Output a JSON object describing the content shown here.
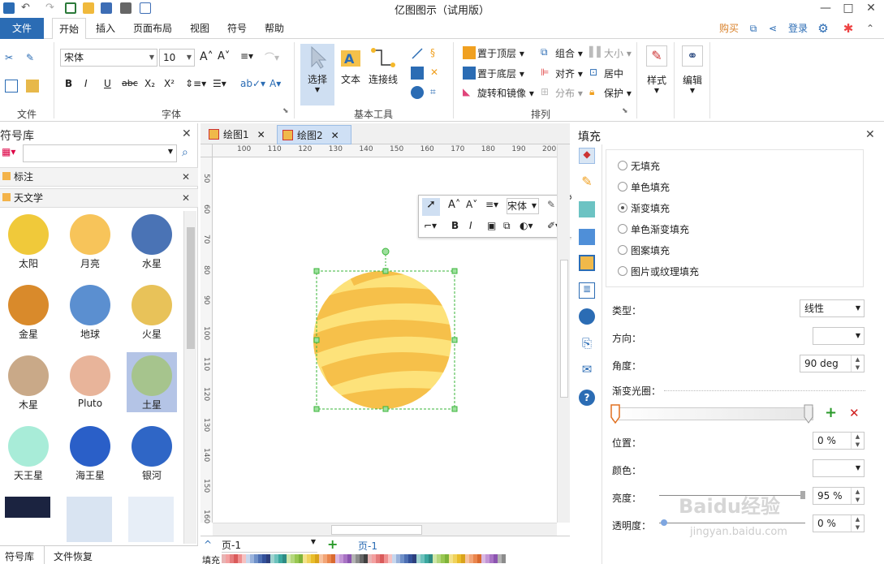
{
  "app": {
    "title": "亿图图示（试用版）"
  },
  "menu": {
    "items": [
      "文件",
      "开始",
      "插入",
      "页面布局",
      "视图",
      "符号",
      "帮助"
    ],
    "right": {
      "buy": "购买",
      "login": "登录"
    }
  },
  "ribbon": {
    "groups": {
      "file": "文件",
      "font": "字体",
      "basic_tools": "基本工具",
      "arrange": "排列"
    },
    "font_name": "宋体",
    "font_size": "10",
    "basic": {
      "select": "选择",
      "text": "文本",
      "connector": "连接线"
    },
    "arrange": {
      "bring_front": "置于顶层",
      "send_back": "置于底层",
      "rotate": "旋转和镜像",
      "group": "组合",
      "align": "对齐",
      "distribute": "分布",
      "size": "大小",
      "center": "居中",
      "protect": "保护"
    },
    "style": "样式",
    "edit": "编辑"
  },
  "library": {
    "title": "符号库",
    "search_placeholder": "",
    "sections": [
      "标注",
      "天文学"
    ],
    "symbols": [
      {
        "label": "太阳",
        "color": "#f0c93a"
      },
      {
        "label": "月亮",
        "color": "#f7c45a"
      },
      {
        "label": "水星",
        "color": "#4a73b5"
      },
      {
        "label": "金星",
        "color": "#d98a2b"
      },
      {
        "label": "地球",
        "color": "#5b8fd0"
      },
      {
        "label": "火星",
        "color": "#e8c259"
      },
      {
        "label": "木星",
        "color": "#c9a988"
      },
      {
        "label": "Pluto",
        "color": "#e8b49a"
      },
      {
        "label": "土星",
        "color": "#a6c48d"
      },
      {
        "label": "天王星",
        "color": "#a8ecd8"
      },
      {
        "label": "海王星",
        "color": "#2a5fc8"
      },
      {
        "label": "银河",
        "color": "#2f66c6"
      }
    ],
    "bottom_tabs": [
      "符号库",
      "文件恢复"
    ]
  },
  "doc_tabs": [
    "绘图1",
    "绘图2"
  ],
  "ruler": {
    "h": [
      "100",
      "110",
      "120",
      "130",
      "140",
      "150",
      "160",
      "170",
      "180",
      "190",
      "200"
    ],
    "v": [
      "50",
      "60",
      "70",
      "80",
      "90",
      "100",
      "110",
      "120",
      "130",
      "140",
      "150",
      "160"
    ]
  },
  "float_toolbar": {
    "font": "宋体"
  },
  "page_bar": {
    "page_select": "页-1",
    "page_tab": "页-1",
    "fill_label": "填充"
  },
  "fill_panel": {
    "title": "填充",
    "options": [
      {
        "label": "无填充",
        "selected": false
      },
      {
        "label": "单色填充",
        "selected": false
      },
      {
        "label": "渐变填充",
        "selected": true
      },
      {
        "label": "单色渐变填充",
        "selected": false
      },
      {
        "label": "图案填充",
        "selected": false
      },
      {
        "label": "图片或纹理填充",
        "selected": false
      }
    ],
    "type_label": "类型：",
    "type_value": "线性",
    "direction_label": "方向：",
    "angle_label": "角度：",
    "angle_value": "90 deg",
    "aperture_label": "渐变光圈：",
    "position_label": "位置：",
    "position_value": "0 %",
    "color_label": "颜色：",
    "brightness_label": "亮度：",
    "brightness_value": "95 %",
    "transparency_label": "透明度：",
    "transparency_value": "0 %"
  },
  "watermark": {
    "logo": "Baidu经验",
    "url": "jingyan.baidu.com"
  },
  "colors": {
    "accent": "#2b6cb4",
    "selection": "#b4c4e6",
    "handle": "#4fbf4f",
    "planet_light": "#fde27a",
    "planet_dark": "#f6c04a"
  }
}
